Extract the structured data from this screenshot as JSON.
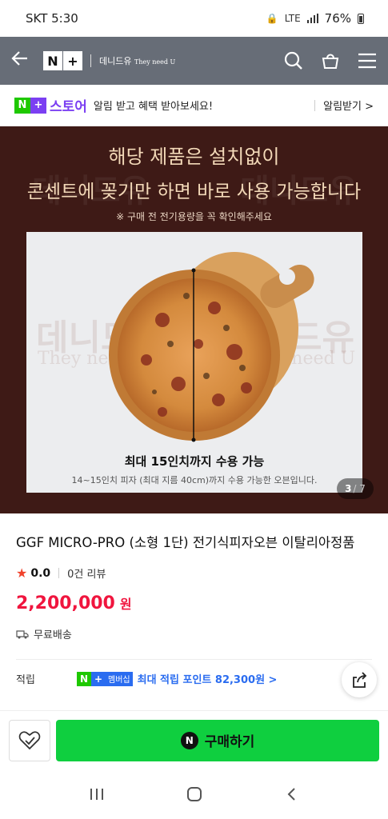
{
  "status": {
    "carrier_time": "SKT 5:30",
    "battery": "76%",
    "network": "LTE"
  },
  "header": {
    "brand_name": "데니드유",
    "brand_tagline": "They need U",
    "icons": [
      "back-icon",
      "search-icon",
      "cart-icon",
      "menu-icon"
    ]
  },
  "store_banner": {
    "store_label": "스토어",
    "message": "알림 받고 혜택 받아보세요!",
    "cta": "알림받기 >"
  },
  "hero": {
    "headline1": "해당 제품은 설치없이",
    "headline2": "콘센트에 꽂기만 하면 바로 사용 가능합니다",
    "note": "※ 구매 전 전기용량을 꼭 확인해주세요",
    "caption": "최대 15인치까지 수용 가능",
    "subcaption": "14~15인치 피자 (최대 지름 40cm)까지 수용 가능한 오븐입니다.",
    "watermark1": "데니드유",
    "watermark2": "They need U",
    "counter_current": "3",
    "counter_total": "/ 7"
  },
  "product": {
    "title": "GGF MICRO-PRO (소형 1단) 전기식피자오븐 이탈리아정품",
    "rating": "0.0",
    "reviews": "0건 리뷰",
    "price": "2,200,000",
    "currency": "원",
    "shipping": "무료배송",
    "points_label": "적립",
    "points_badge": "멤버십",
    "points_text": "최대 적립 포인트 82,300원 >"
  },
  "buybar": {
    "buy_label": "구매하기"
  },
  "colors": {
    "accent_green": "#0fcf3f",
    "price_red": "#f0153e",
    "store_purple": "#7b3ff2",
    "hero_bg": "#3e1a16"
  }
}
